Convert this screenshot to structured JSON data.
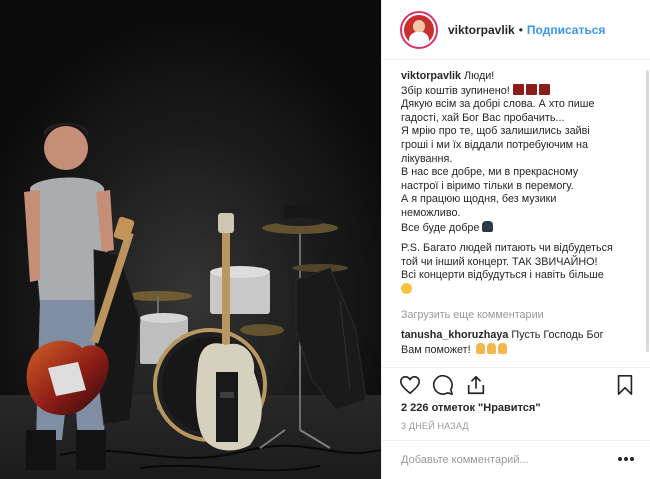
{
  "post": {
    "username": "viktorpavlik",
    "follow_label": "Подписаться",
    "separator": "•",
    "caption_lines": [
      "Люди!",
      "Збір коштів зупинено!",
      "Дякую всім за добрі слова. А хто пише",
      "гадості, хай Бог Вас пробачить...",
      "Я мрію про те, щоб залишились зайві",
      "гроші і ми їх віддали потребуючим на",
      "лікування.",
      "В нас все добре, ми в прекрасному",
      "настрої і віримо тільки в перемогу.",
      "А я працюю щодня, без музики",
      "неможливо.",
      "Все буде добре",
      "P.S. Багато людей питають чи відбудеться",
      "той чи інший концерт. ТАК ЗВИЧАЙНО!",
      "Всі концерти відбудуться і навіть більше"
    ],
    "load_more_label": "Загрузить еще комментарии",
    "comment": {
      "username": "tanusha_khoruzhaya",
      "text_line1": "Пусть Господь Бог",
      "text_line2": "Вам поможет!"
    },
    "likes_text": "2 226 отметок \"Нравится\"",
    "time_ago": "3 дней назад",
    "comment_placeholder": "Добавьте комментарий...",
    "icons": {
      "like": "heart-outline-icon",
      "comment": "speech-bubble-icon",
      "share": "share-icon",
      "save": "bookmark-icon",
      "more": "more-dots-icon"
    },
    "colors": {
      "link_blue": "#3897f0",
      "muted": "#999999",
      "text": "#262626"
    }
  }
}
